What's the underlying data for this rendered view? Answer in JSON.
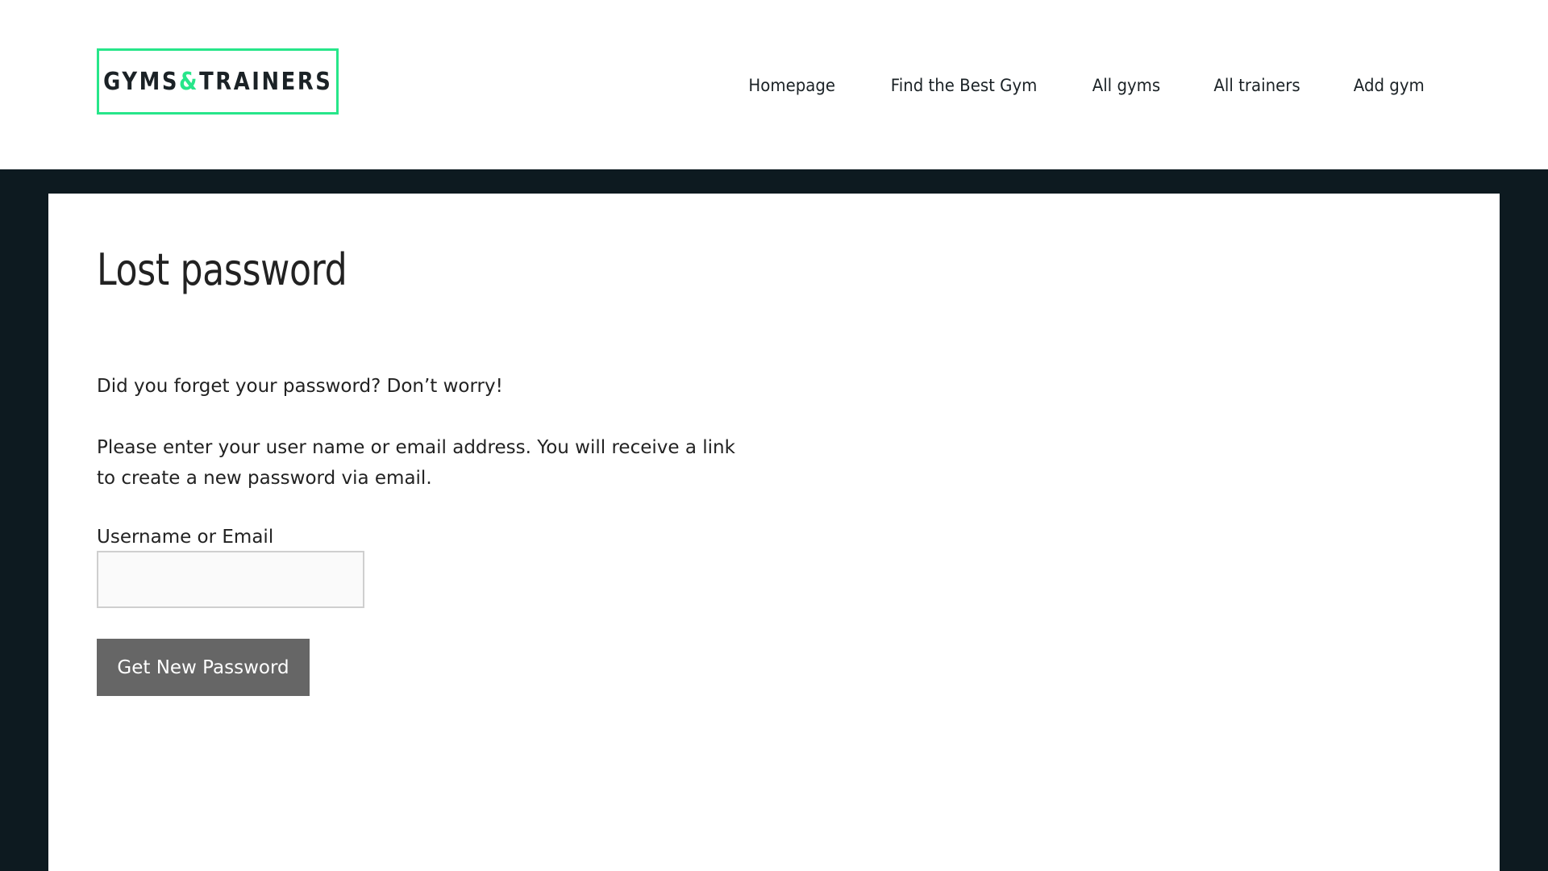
{
  "header": {
    "logo": {
      "text_before": "GYMS",
      "ampersand": "&",
      "text_after": "TRAINERS"
    },
    "nav": [
      {
        "label": "Homepage"
      },
      {
        "label": "Find the Best Gym"
      },
      {
        "label": "All gyms"
      },
      {
        "label": "All trainers"
      },
      {
        "label": "Add gym"
      }
    ]
  },
  "main": {
    "title": "Lost password",
    "intro": "Did you forget your password? Don’t worry!",
    "instructions": "Please enter your user name or email address. You will receive a link to create a new password via email.",
    "form": {
      "username_label": "Username or Email",
      "username_value": "",
      "username_placeholder": "",
      "submit_label": "Get New Password"
    }
  },
  "colors": {
    "accent": "#27e68a",
    "dark_band": "#0d1a20",
    "button": "#666666"
  }
}
